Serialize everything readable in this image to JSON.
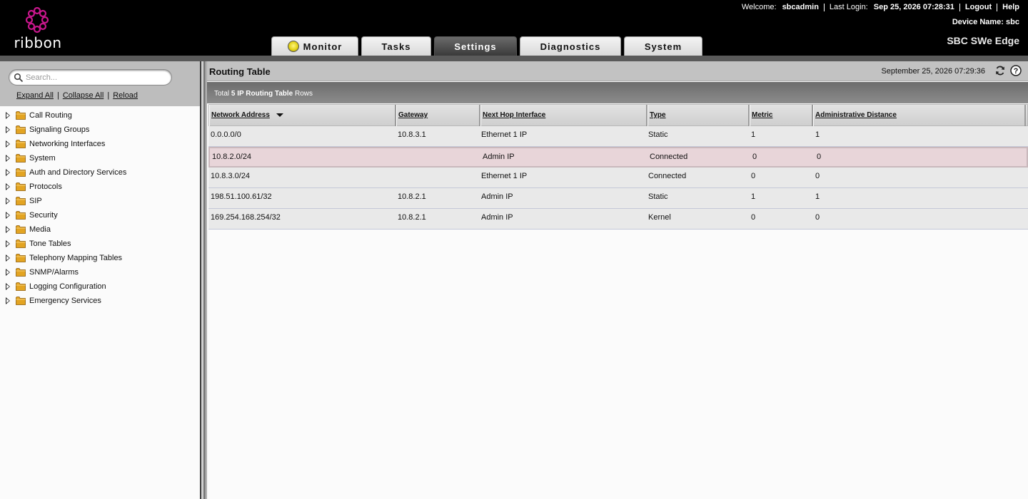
{
  "header": {
    "logo_text": "ribbon",
    "welcome_label": "Welcome:",
    "username": "sbcadmin",
    "last_login_label": "Last Login:",
    "last_login_value": "Sep 25, 2026 07:28:31",
    "logout": "Logout",
    "help": "Help",
    "device_name_label": "Device Name:",
    "device_name_value": "sbc",
    "product": "SBC SWe Edge"
  },
  "tabs": [
    {
      "label": "Monitor",
      "active": false
    },
    {
      "label": "Tasks",
      "active": false
    },
    {
      "label": "Settings",
      "active": true
    },
    {
      "label": "Diagnostics",
      "active": false
    },
    {
      "label": "System",
      "active": false
    }
  ],
  "sidebar": {
    "search_placeholder": "Search...",
    "expand_all": "Expand All",
    "collapse_all": "Collapse All",
    "reload": "Reload",
    "items": [
      "Call Routing",
      "Signaling Groups",
      "Networking Interfaces",
      "System",
      "Auth and Directory Services",
      "Protocols",
      "SIP",
      "Security",
      "Media",
      "Tone Tables",
      "Telephony Mapping Tables",
      "SNMP/Alarms",
      "Logging Configuration",
      "Emergency Services"
    ]
  },
  "main": {
    "title": "Routing Table",
    "timestamp": "September 25, 2026 07:29:36",
    "summary_prefix": "Total",
    "summary_bold": "5 IP Routing Table",
    "summary_suffix": "Rows",
    "columns": [
      "Network Address",
      "Gateway",
      "Next Hop Interface",
      "Type",
      "Metric",
      "Administrative Distance"
    ],
    "rows": [
      [
        "0.0.0.0/0",
        "10.8.3.1",
        "Ethernet 1 IP",
        "Static",
        "1",
        "1"
      ],
      [
        "10.8.2.0/24",
        "",
        "Admin IP",
        "Connected",
        "0",
        "0"
      ],
      [
        "10.8.3.0/24",
        "",
        "Ethernet 1 IP",
        "Connected",
        "0",
        "0"
      ],
      [
        "198.51.100.61/32",
        "10.8.2.1",
        "Admin IP",
        "Static",
        "1",
        "1"
      ],
      [
        "169.254.168.254/32",
        "10.8.2.1",
        "Admin IP",
        "Kernel",
        "0",
        "0"
      ]
    ],
    "selected_row": 1
  },
  "colors": {
    "header_bg": "#000000",
    "logo_accent": "#c8168c",
    "active_tab": "#3a3a3a",
    "selected_row": "#e8d5d9"
  },
  "icons": {
    "logo": "ribbon-logo-icon",
    "monitor": "status-light-icon",
    "search": "search-icon",
    "folder": "folder-icon",
    "expander": "triangle-right-icon",
    "refresh": "refresh-icon",
    "help": "help-icon",
    "sort": "sort-descending-icon"
  }
}
